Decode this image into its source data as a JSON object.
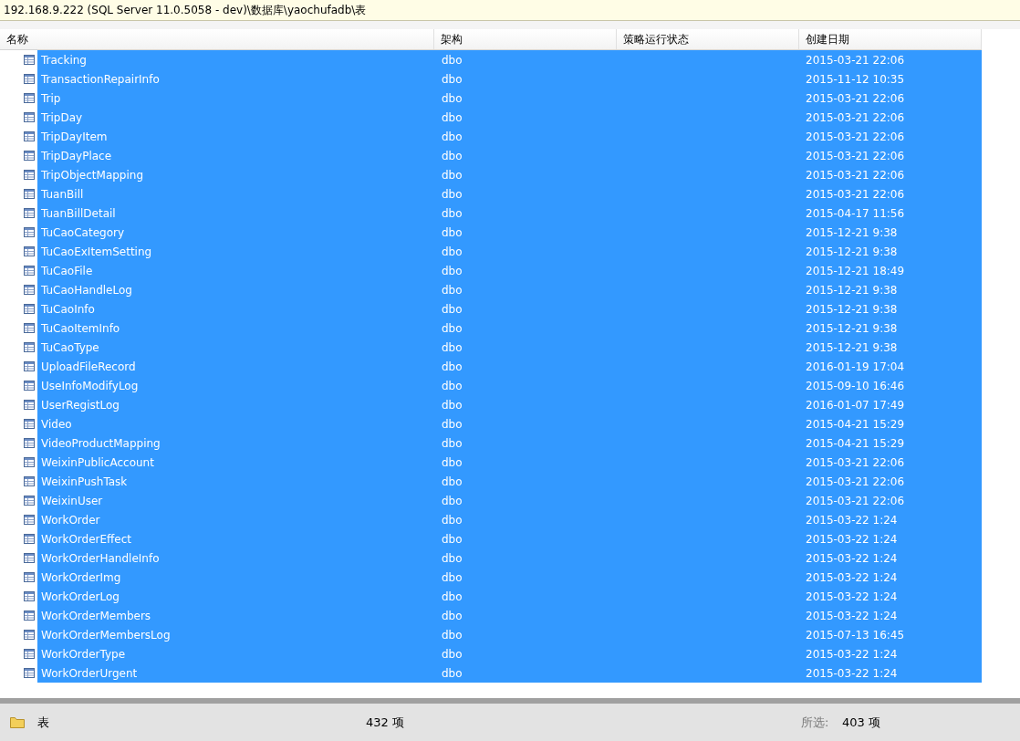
{
  "path_bar": {
    "text": "192.168.9.222 (SQL Server 11.0.5058 - dev)\\数据库\\yaochufadb\\表"
  },
  "table": {
    "columns": [
      "名称",
      "架构",
      "策略运行状态",
      "创建日期"
    ],
    "rows": [
      {
        "name": "Tracking",
        "schema": "dbo",
        "created": "2015-03-21 22:06",
        "selected": true
      },
      {
        "name": "TransactionRepairInfo",
        "schema": "dbo",
        "created": "2015-11-12 10:35",
        "selected": true
      },
      {
        "name": "Trip",
        "schema": "dbo",
        "created": "2015-03-21 22:06",
        "selected": true
      },
      {
        "name": "TripDay",
        "schema": "dbo",
        "created": "2015-03-21 22:06",
        "selected": true
      },
      {
        "name": "TripDayItem",
        "schema": "dbo",
        "created": "2015-03-21 22:06",
        "selected": true
      },
      {
        "name": "TripDayPlace",
        "schema": "dbo",
        "created": "2015-03-21 22:06",
        "selected": true
      },
      {
        "name": "TripObjectMapping",
        "schema": "dbo",
        "created": "2015-03-21 22:06",
        "selected": true
      },
      {
        "name": "TuanBill",
        "schema": "dbo",
        "created": "2015-03-21 22:06",
        "selected": true
      },
      {
        "name": "TuanBillDetail",
        "schema": "dbo",
        "created": "2015-04-17 11:56",
        "selected": true
      },
      {
        "name": "TuCaoCategory",
        "schema": "dbo",
        "created": "2015-12-21 9:38",
        "selected": true
      },
      {
        "name": "TuCaoExItemSetting",
        "schema": "dbo",
        "created": "2015-12-21 9:38",
        "selected": true
      },
      {
        "name": "TuCaoFile",
        "schema": "dbo",
        "created": "2015-12-21 18:49",
        "selected": true
      },
      {
        "name": "TuCaoHandleLog",
        "schema": "dbo",
        "created": "2015-12-21 9:38",
        "selected": true
      },
      {
        "name": "TuCaoInfo",
        "schema": "dbo",
        "created": "2015-12-21 9:38",
        "selected": true
      },
      {
        "name": "TuCaoItemInfo",
        "schema": "dbo",
        "created": "2015-12-21 9:38",
        "selected": true
      },
      {
        "name": "TuCaoType",
        "schema": "dbo",
        "created": "2015-12-21 9:38",
        "selected": true
      },
      {
        "name": "UploadFileRecord",
        "schema": "dbo",
        "created": "2016-01-19 17:04",
        "selected": true
      },
      {
        "name": "UseInfoModifyLog",
        "schema": "dbo",
        "created": "2015-09-10 16:46",
        "selected": true
      },
      {
        "name": "UserRegistLog",
        "schema": "dbo",
        "created": "2016-01-07 17:49",
        "selected": true
      },
      {
        "name": "Video",
        "schema": "dbo",
        "created": "2015-04-21 15:29",
        "selected": true
      },
      {
        "name": "VideoProductMapping",
        "schema": "dbo",
        "created": "2015-04-21 15:29",
        "selected": true
      },
      {
        "name": "WeixinPublicAccount",
        "schema": "dbo",
        "created": "2015-03-21 22:06",
        "selected": true
      },
      {
        "name": "WeixinPushTask",
        "schema": "dbo",
        "created": "2015-03-21 22:06",
        "selected": true
      },
      {
        "name": "WeixinUser",
        "schema": "dbo",
        "created": "2015-03-21 22:06",
        "selected": true
      },
      {
        "name": "WorkOrder",
        "schema": "dbo",
        "created": "2015-03-22 1:24",
        "selected": true
      },
      {
        "name": "WorkOrderEffect",
        "schema": "dbo",
        "created": "2015-03-22 1:24",
        "selected": true
      },
      {
        "name": "WorkOrderHandleInfo",
        "schema": "dbo",
        "created": "2015-03-22 1:24",
        "selected": true
      },
      {
        "name": "WorkOrderImg",
        "schema": "dbo",
        "created": "2015-03-22 1:24",
        "selected": true
      },
      {
        "name": "WorkOrderLog",
        "schema": "dbo",
        "created": "2015-03-22 1:24",
        "selected": true
      },
      {
        "name": "WorkOrderMembers",
        "schema": "dbo",
        "created": "2015-03-22 1:24",
        "selected": true
      },
      {
        "name": "WorkOrderMembersLog",
        "schema": "dbo",
        "created": "2015-07-13 16:45",
        "selected": true
      },
      {
        "name": "WorkOrderType",
        "schema": "dbo",
        "created": "2015-03-22 1:24",
        "selected": true
      },
      {
        "name": "WorkOrderUrgent",
        "schema": "dbo",
        "created": "2015-03-22 1:24",
        "selected": true
      }
    ]
  },
  "status_bar": {
    "folder": "表",
    "count": "432 项",
    "selected_label": "所选:",
    "selected_count": "403 项"
  }
}
